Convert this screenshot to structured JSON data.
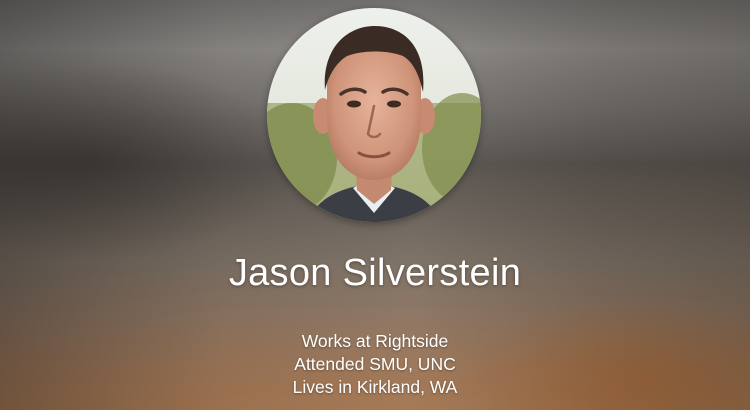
{
  "profile": {
    "name": "Jason Silverstein",
    "details": [
      "Works at Rightside",
      "Attended SMU, UNC",
      "Lives in Kirkland, WA"
    ]
  },
  "colors": {
    "text": "#ffffff",
    "background_top": "#8a8784",
    "background_bottom": "#a47650"
  }
}
